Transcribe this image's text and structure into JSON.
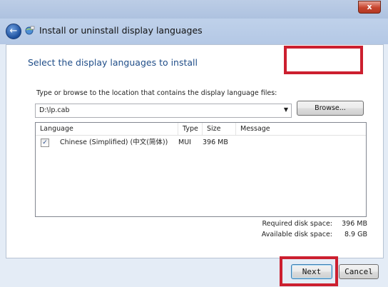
{
  "window": {
    "close_glyph": "x"
  },
  "nav": {
    "title": "Install or uninstall display languages",
    "back_icon": "back-arrow-icon",
    "app_icon": "globe-language-icon"
  },
  "main": {
    "heading": "Select the display languages to install",
    "instruction": "Type or browse to the location that contains the display language files:",
    "path_value": "D:\\lp.cab",
    "browse_label": "Browse...",
    "table": {
      "columns": [
        "Language",
        "Type",
        "Size",
        "Message"
      ],
      "rows": [
        {
          "checked": true,
          "language": "Chinese (Simplified) (中文(简体))",
          "type": "MUI",
          "size": "396 MB",
          "message": ""
        }
      ]
    },
    "required_label": "Required disk space:",
    "required_value": "396 MB",
    "available_label": "Available disk space:",
    "available_value": "8.9 GB"
  },
  "footer": {
    "next_label": "Next",
    "cancel_label": "Cancel"
  },
  "colors": {
    "highlight": "#cc1f2f",
    "heading": "#1f4d88"
  }
}
